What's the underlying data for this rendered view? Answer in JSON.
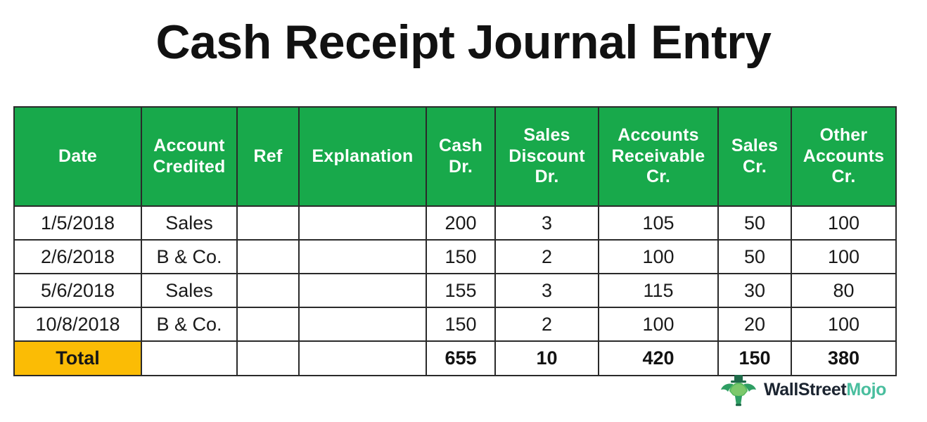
{
  "title": "Cash Receipt Journal Entry",
  "colors": {
    "header_green": "#18A94B",
    "total_highlight": "#FBBC05",
    "border": "#2a2a2a",
    "title_text": "#111111",
    "logo_dark": "#1B2430",
    "logo_accent": "#49BE9E"
  },
  "table": {
    "columns": [
      {
        "key": "date",
        "lines": [
          "Date"
        ]
      },
      {
        "key": "account",
        "lines": [
          "Account",
          "Credited"
        ]
      },
      {
        "key": "ref",
        "lines": [
          "Ref"
        ]
      },
      {
        "key": "explanation",
        "lines": [
          "Explanation"
        ]
      },
      {
        "key": "cash",
        "lines": [
          "Cash",
          "Dr."
        ]
      },
      {
        "key": "discount",
        "lines": [
          "Sales",
          "Discount",
          "Dr."
        ]
      },
      {
        "key": "ar",
        "lines": [
          "Accounts",
          "Receivable",
          "Cr."
        ]
      },
      {
        "key": "salescr",
        "lines": [
          "Sales",
          "Cr."
        ]
      },
      {
        "key": "other",
        "lines": [
          "Other",
          "Accounts",
          "Cr."
        ]
      }
    ],
    "rows": [
      {
        "date": "1/5/2018",
        "account": "Sales",
        "ref": "",
        "explanation": "",
        "cash": "200",
        "discount": "3",
        "ar": "105",
        "salescr": "50",
        "other": "100"
      },
      {
        "date": "2/6/2018",
        "account": "B & Co.",
        "ref": "",
        "explanation": "",
        "cash": "150",
        "discount": "2",
        "ar": "100",
        "salescr": "50",
        "other": "100"
      },
      {
        "date": "5/6/2018",
        "account": "Sales",
        "ref": "",
        "explanation": "",
        "cash": "155",
        "discount": "3",
        "ar": "115",
        "salescr": "30",
        "other": "80"
      },
      {
        "date": "10/8/2018",
        "account": "B & Co.",
        "ref": "",
        "explanation": "",
        "cash": "150",
        "discount": "2",
        "ar": "100",
        "salescr": "20",
        "other": "100"
      }
    ],
    "total": {
      "label": "Total",
      "account": "",
      "ref": "",
      "explanation": "",
      "cash": "655",
      "discount": "10",
      "ar": "420",
      "salescr": "150",
      "other": "380"
    }
  },
  "logo": {
    "icon": "wallstreetmojo-mascot-icon",
    "text_primary": "WallStreet",
    "text_accent": "Mojo"
  }
}
